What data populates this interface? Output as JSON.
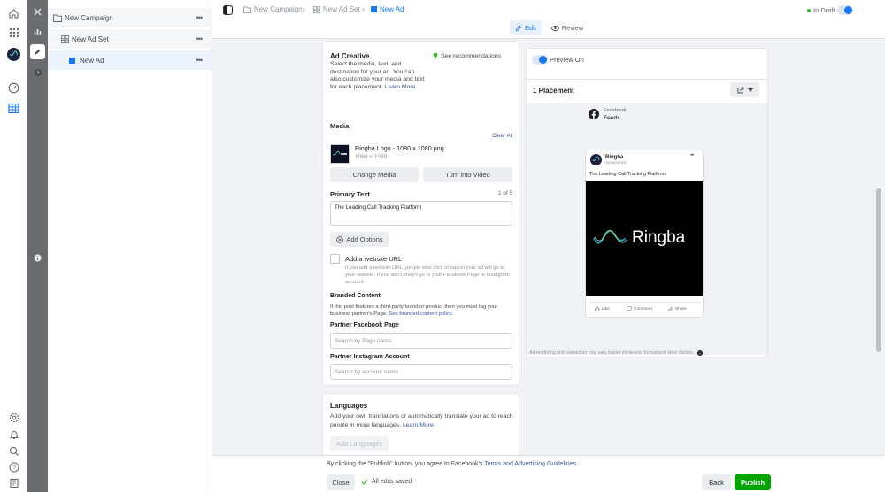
{
  "breadcrumb": {
    "campaign": "New Campaign",
    "adset": "New Ad Set",
    "ad": "New Ad"
  },
  "tree": {
    "campaign": "New Campaign",
    "adset": "New Ad Set",
    "ad": "New Ad"
  },
  "status": "In Draft",
  "tabs": {
    "edit": "Edit",
    "review": "Review"
  },
  "creative": {
    "title": "Ad Creative",
    "description": "Select the media, text, and destination for your ad. You can also customize your media and text for each placement.",
    "learn_more": "Learn More",
    "see_recommendations": "See recommendations",
    "media_label": "Media",
    "clear_all": "Clear All",
    "media_name": "Ringba Logo - 1080 x 1080.png",
    "media_dims": "1080 × 1080",
    "change_media": "Change Media",
    "turn_into_video": "Turn into Video",
    "primary_text_label": "Primary Text",
    "primary_text_count": "1 of 5",
    "primary_text_value": "The Leading Call Tracking Platform",
    "add_options": "Add Options",
    "website_url_label": "Add a website URL",
    "website_url_help": "If you add a website URL, people who click or tap on your ad will go to your website. If you don't, they'll go to your Facebook Page or Instagram account.",
    "branded_label": "Branded Content",
    "branded_help": "If this post features a third-party brand or product then you must tag your business partner's Page.",
    "branded_link": "See branded content policy.",
    "partner_fb_label": "Partner Facebook Page",
    "partner_fb_placeholder": "Search by Page name",
    "partner_ig_label": "Partner Instagram Account",
    "partner_ig_placeholder": "Search by account name"
  },
  "languages": {
    "title": "Languages",
    "description": "Add your own translations or automatically translate your ad to reach people in more languages.",
    "learn_more": "Learn More.",
    "add_button": "Add Languages"
  },
  "preview": {
    "toggle_label": "Preview On",
    "placement_title": "1 Placement",
    "platform": "Facebook",
    "placement": "Feeds",
    "page_name": "Ringba",
    "sponsored": "Sponsored",
    "post_text": "The Leading Call Tracking Platform",
    "brand_word": "Ringba",
    "like": "Like",
    "comment": "Comment",
    "share": "Share",
    "disclaimer": "Ad rendering and interaction may vary based on device, format and other factors."
  },
  "footer": {
    "notice_prefix": "By clicking the \"Publish\" button, you agree to Facebook's",
    "notice_link": "Terms and Advertising Guidelines",
    "close": "Close",
    "saved": "All edits saved",
    "back": "Back",
    "publish": "Publish"
  },
  "colors": {
    "accent": "#1877f2",
    "publish_green": "#00a400",
    "status_green": "#42b72a",
    "rail_gray": "#6a6c70"
  }
}
